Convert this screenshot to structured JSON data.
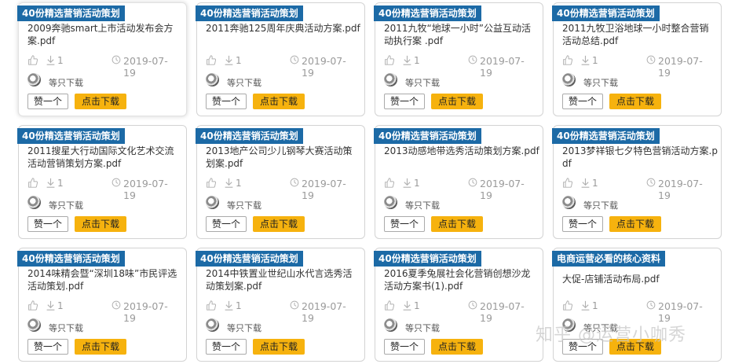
{
  "cards": [
    {
      "tag": "40份精选营销活动策划",
      "title": "2009奔驰smart上市活动发布会方案.pdf",
      "likes": "",
      "downloads": "1",
      "date": "2019-07-19",
      "author": "等只下载",
      "like_btn": "赞一个",
      "download_btn": "点击下载"
    },
    {
      "tag": "40份精选营销活动策划",
      "title": "2011奔驰125周年庆典活动方案.pdf",
      "likes": "",
      "downloads": "1",
      "date": "2019-07-19",
      "author": "等只下载",
      "like_btn": "赞一个",
      "download_btn": "点击下载"
    },
    {
      "tag": "40份精选营销活动策划",
      "title": "2011九牧“地球一小时”公益互动活动执行案 .pdf",
      "likes": "",
      "downloads": "1",
      "date": "2019-07-19",
      "author": "等只下载",
      "like_btn": "赞一个",
      "download_btn": "点击下载"
    },
    {
      "tag": "40份精选营销活动策划",
      "title": "2011九牧卫浴地球一小时整合营销活动总结.pdf",
      "likes": "",
      "downloads": "1",
      "date": "2019-07-19",
      "author": "等只下载",
      "like_btn": "赞一个",
      "download_btn": "点击下载"
    },
    {
      "tag": "40份精选营销活动策划",
      "title": "2011搜星大行动国际文化艺术交流活动营销策划方案.pdf",
      "likes": "",
      "downloads": "1",
      "date": "2019-07-19",
      "author": "等只下载",
      "like_btn": "赞一个",
      "download_btn": "点击下载"
    },
    {
      "tag": "40份精选营销活动策划",
      "title": "2013地产公司少儿钢琴大赛活动策划案.pdf",
      "likes": "",
      "downloads": "1",
      "date": "2019-07-19",
      "author": "等只下载",
      "like_btn": "赞一个",
      "download_btn": "点击下载"
    },
    {
      "tag": "40份精选营销活动策划",
      "title": "2013动感地带选秀活动策划方案.pdf",
      "likes": "",
      "downloads": "1",
      "date": "2019-07-19",
      "author": "等只下载",
      "like_btn": "赞一个",
      "download_btn": "点击下载"
    },
    {
      "tag": "40份精选营销活动策划",
      "title": "2013梦祥银七夕特色营销活动方案.pdf",
      "likes": "",
      "downloads": "1",
      "date": "2019-07-19",
      "author": "等只下载",
      "like_btn": "赞一个",
      "download_btn": "点击下载"
    },
    {
      "tag": "40份精选营销活动策划",
      "title": "2014味精会暨“深圳18味”市民评选活动策划.pdf",
      "likes": "",
      "downloads": "1",
      "date": "2019-07-19",
      "author": "等只下载",
      "like_btn": "赞一个",
      "download_btn": "点击下载"
    },
    {
      "tag": "40份精选营销活动策划",
      "title": "2014中铁置业世纪山水代言选秀活动策划案.pdf",
      "likes": "",
      "downloads": "1",
      "date": "2019-07-19",
      "author": "等只下载",
      "like_btn": "赞一个",
      "download_btn": "点击下载"
    },
    {
      "tag": "40份精选营销活动策划",
      "title": "2016夏季兔展社会化营销创想沙龙活动方案书(1).pdf",
      "likes": "",
      "downloads": "1",
      "date": "2019-07-19",
      "author": "等只下载",
      "like_btn": "赞一个",
      "download_btn": "点击下载"
    },
    {
      "tag": "电商运营必看的核心资料",
      "title": "大促-店铺活动布局.pdf",
      "likes": "",
      "downloads": "1",
      "date": "2019-07-19",
      "author": "等只下载",
      "like_btn": "赞一个",
      "download_btn": "点击下载"
    }
  ],
  "watermark": "知乎 @运营小咖秀",
  "icons": {
    "like": "thumbs-up-icon",
    "download": "download-icon",
    "clock": "clock-icon",
    "avatar": "avatar-icon"
  },
  "colors": {
    "tag_bg": "#1c6aa6",
    "download_btn": "#f6b20e"
  }
}
